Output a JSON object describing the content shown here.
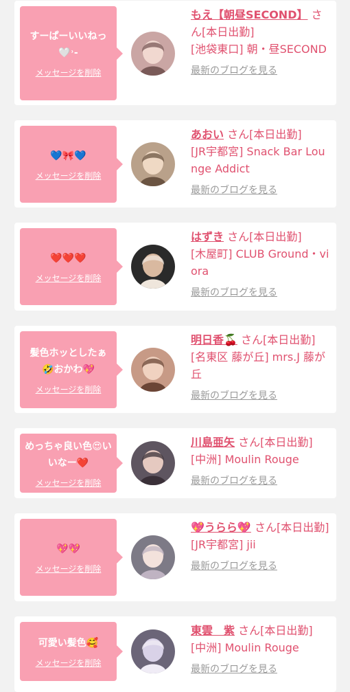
{
  "messages": [
    {
      "bubble_text": "すーぱーいいねっ🤍˒-",
      "delete_label": "メッセージを削除",
      "name": "もえ【朝昼SECOND】",
      "name_suffix": "さん[本日出勤]",
      "shop": "[池袋東口] 朝・昼SECOND",
      "blog_label": "最新のブログを見る",
      "avatar_icon": "profile-photo-icon"
    },
    {
      "bubble_text": "💙🎀💙",
      "delete_label": "メッセージを削除",
      "name": "あおい",
      "name_suffix": "さん[本日出勤]",
      "shop": "[JR宇都宮] Snack Bar Lounge Addict",
      "blog_label": "最新のブログを見る",
      "avatar_icon": "profile-photo-icon"
    },
    {
      "bubble_text": "❤️❤️❤️",
      "delete_label": "メッセージを削除",
      "name": "はずき",
      "name_suffix": "さん[本日出勤]",
      "shop": "[木屋町] CLUB Ground・viora",
      "blog_label": "最新のブログを見る",
      "avatar_icon": "profile-photo-icon"
    },
    {
      "bubble_text": "髪色ホッとしたぁ🤣おかわ💖",
      "delete_label": "メッセージを削除",
      "name": "明日香🍒",
      "name_suffix": "さん[本日出勤]",
      "shop": "[名東区 藤が丘] mrs.J 藤が丘",
      "blog_label": "最新のブログを見る",
      "avatar_icon": "profile-photo-icon"
    },
    {
      "bubble_text": "めっちゃ良い色😍いいなー❤️",
      "delete_label": "メッセージを削除",
      "name": "川島亜矢",
      "name_suffix": "さん[本日出勤]",
      "shop": "[中洲] Moulin Rouge",
      "blog_label": "最新のブログを見る",
      "avatar_icon": "profile-photo-icon"
    },
    {
      "bubble_text": "💖💖",
      "delete_label": "メッセージを削除",
      "name": "💖うらら💖",
      "name_suffix": "さん[本日出勤]",
      "shop": "[JR宇都宮] jii",
      "blog_label": "最新のブログを見る",
      "avatar_icon": "profile-photo-icon"
    },
    {
      "bubble_text": "可愛い髪色🥰",
      "delete_label": "メッセージを削除",
      "name": "東雲　紫",
      "name_suffix": "さん[本日出勤]",
      "shop": "[中洲] Moulin Rouge",
      "blog_label": "最新のブログを見る",
      "avatar_icon": "profile-photo-icon"
    }
  ],
  "colors": {
    "page_bg": "#f2f2f2",
    "card_bg": "#ffffff",
    "bubble": "#f9a0b2",
    "accent": "#e0516f",
    "link_gray": "#9a9a9a"
  }
}
